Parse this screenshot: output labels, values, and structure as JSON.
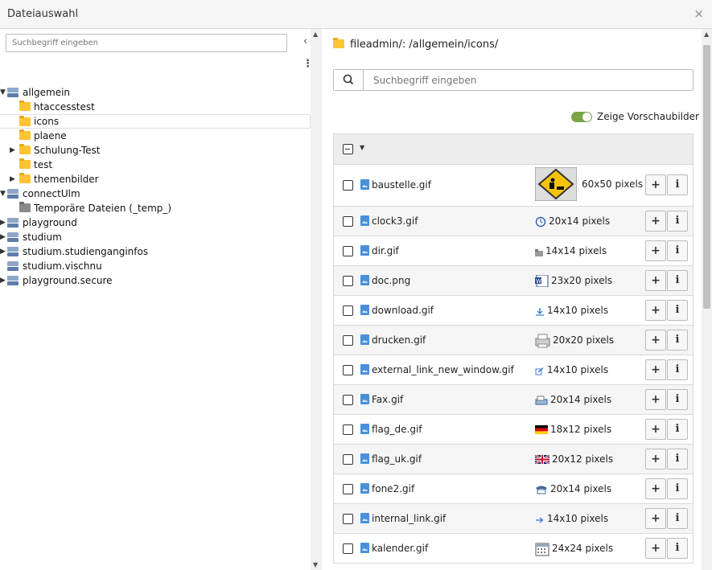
{
  "window": {
    "title": "Dateiauswahl",
    "close": "×"
  },
  "tree": {
    "search_placeholder": "Suchbegriff eingeben",
    "collapse": "‹",
    "menu": "⋮",
    "nodes": [
      {
        "label": "allgemein",
        "type": "storage",
        "level": 0,
        "expanded": true
      },
      {
        "label": "htaccesstest",
        "type": "folder",
        "level": 1
      },
      {
        "label": "icons",
        "type": "folder",
        "level": 1,
        "selected": true
      },
      {
        "label": "plaene",
        "type": "folder",
        "level": 1
      },
      {
        "label": "Schulung-Test",
        "type": "folder",
        "level": 1,
        "collapsed": true
      },
      {
        "label": "test",
        "type": "folder",
        "level": 1
      },
      {
        "label": "themenbilder",
        "type": "folder",
        "level": 1,
        "collapsed": true
      },
      {
        "label": "connectUlm",
        "type": "storage",
        "level": 0,
        "expanded": true
      },
      {
        "label": "Temporäre Dateien (_temp_)",
        "type": "folder-grey",
        "level": 1
      },
      {
        "label": "playground",
        "type": "storage",
        "level": 0,
        "collapsed": true
      },
      {
        "label": "studium",
        "type": "storage",
        "level": 0,
        "collapsed": true
      },
      {
        "label": "studium.studienganginfos",
        "type": "storage",
        "level": 0,
        "collapsed": true
      },
      {
        "label": "studium.vischnu",
        "type": "storage",
        "level": 0
      },
      {
        "label": "playground.secure",
        "type": "storage",
        "level": 0,
        "collapsed": true
      }
    ]
  },
  "main": {
    "path": "fileadmin/: /allgemein/icons/",
    "search_placeholder": "Suchbegriff eingeben",
    "toggle_label": "Zeige Vorschaubilder",
    "toggle_on": true,
    "files": [
      {
        "name": "baustelle.gif",
        "dims": "60x50 pixels",
        "thumb": "construction-sign"
      },
      {
        "name": "clock3.gif",
        "dims": "20x14 pixels",
        "thumb": "clock"
      },
      {
        "name": "dir.gif",
        "dims": "14x14 pixels",
        "thumb": "folder"
      },
      {
        "name": "doc.png",
        "dims": "23x20 pixels",
        "thumb": "word-doc"
      },
      {
        "name": "download.gif",
        "dims": "14x10 pixels",
        "thumb": "download-arrow"
      },
      {
        "name": "drucken.gif",
        "dims": "20x20 pixels",
        "thumb": "printer"
      },
      {
        "name": "external_link_new_window.gif",
        "dims": "14x10 pixels",
        "thumb": "external-link"
      },
      {
        "name": "Fax.gif",
        "dims": "20x14 pixels",
        "thumb": "fax"
      },
      {
        "name": "flag_de.gif",
        "dims": "18x12 pixels",
        "thumb": "german-flag"
      },
      {
        "name": "flag_uk.gif",
        "dims": "20x12 pixels",
        "thumb": "uk-flag"
      },
      {
        "name": "fone2.gif",
        "dims": "20x14 pixels",
        "thumb": "phone"
      },
      {
        "name": "internal_link.gif",
        "dims": "14x10 pixels",
        "thumb": "internal-link"
      },
      {
        "name": "kalender.gif",
        "dims": "24x24 pixels",
        "thumb": "calendar"
      }
    ],
    "add_label": "+",
    "info_label": "i"
  },
  "colors": {
    "accent_toggle": "#79a548",
    "folder": "#ffc435",
    "file_icon": "#4a90d9"
  }
}
